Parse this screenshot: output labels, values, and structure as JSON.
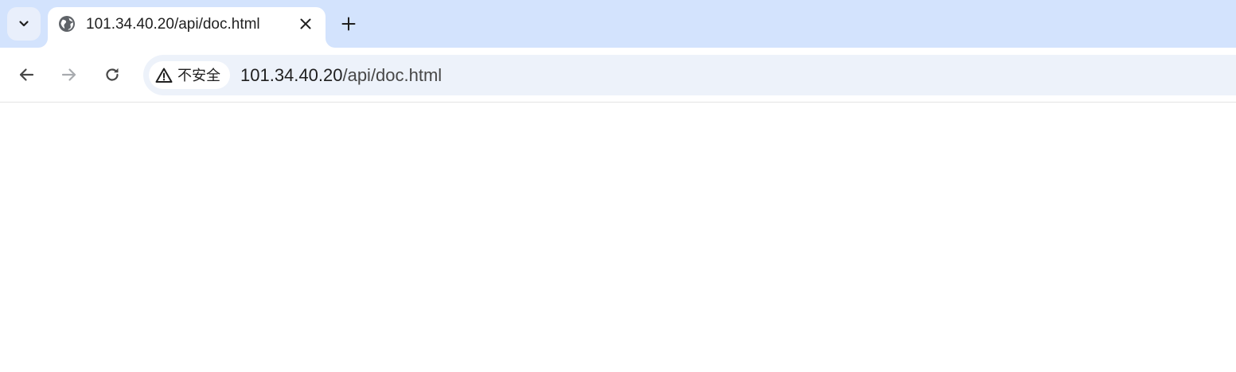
{
  "tab_strip": {
    "tab_search_icon": "chevron-down-icon",
    "active_tab": {
      "favicon": "globe-icon",
      "title": "101.34.40.20/api/doc.html",
      "close_icon": "close-icon"
    },
    "new_tab_icon": "plus-icon"
  },
  "toolbar": {
    "back_icon": "arrow-left-icon",
    "forward_icon": "arrow-right-icon",
    "reload_icon": "reload-icon",
    "omnibox": {
      "security_icon": "warning-triangle-icon",
      "security_label": "不安全",
      "url_host": "101.34.40.20",
      "url_path": "/api/doc.html"
    }
  },
  "colors": {
    "tab_strip_bg": "#d3e3fd",
    "omnibox_bg": "#edf2fa",
    "forward_disabled": "#a8abaf",
    "icon_color": "#474747"
  }
}
